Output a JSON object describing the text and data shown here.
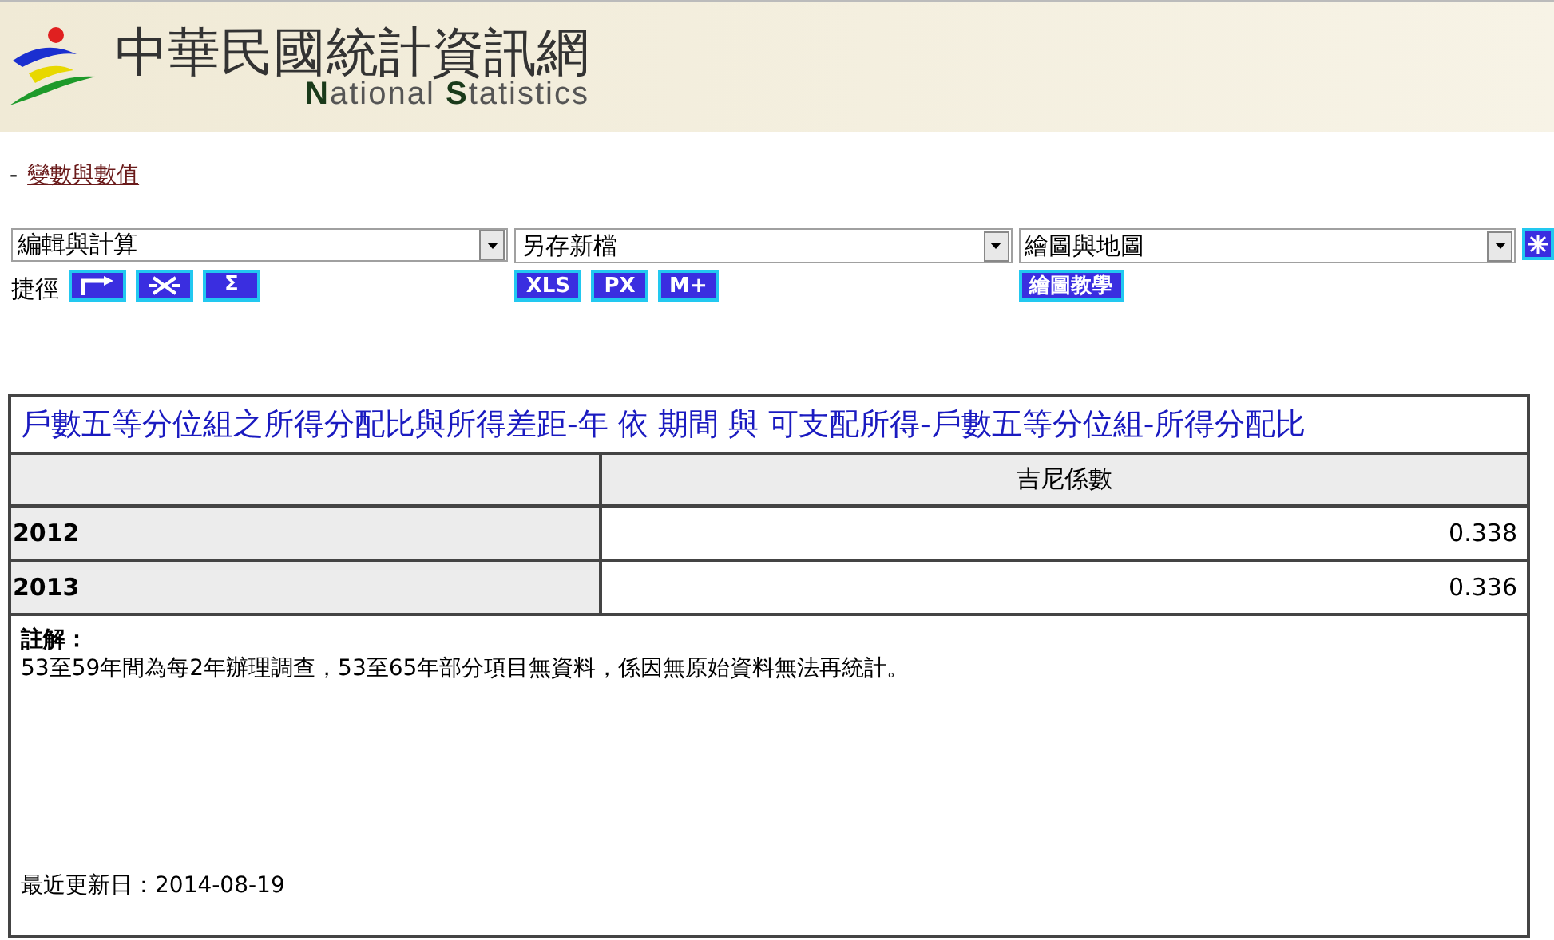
{
  "header": {
    "title": "中華民國統計資訊網",
    "subtitle_initial_1": "N",
    "subtitle_rest_1": "ational",
    "subtitle_initial_2": "S",
    "subtitle_rest_2": "tatistics"
  },
  "breadcrumb": {
    "dash": "-",
    "link": "變數與數值"
  },
  "toolbar": {
    "selects": [
      {
        "value": "編輯與計算"
      },
      {
        "value": "另存新檔"
      },
      {
        "value": "繪圖與地圖"
      }
    ],
    "shortcut_label": "捷徑",
    "groups": [
      [
        {
          "kind": "turn"
        },
        {
          "kind": "cross"
        },
        {
          "kind": "text",
          "label": "Σ"
        }
      ],
      [
        {
          "kind": "text",
          "label": "XLS"
        },
        {
          "kind": "text",
          "label": "PX"
        },
        {
          "kind": "text",
          "label": "M+"
        }
      ],
      [
        {
          "kind": "text",
          "label": "繪圖教學"
        }
      ]
    ]
  },
  "table": {
    "title": "戶數五等分位組之所得分配比與所得差距-年 依 期間 與 可支配所得-戶數五等分位組-所得分配比",
    "columns": [
      "吉尼係數"
    ],
    "rows": [
      {
        "label": "2012",
        "value": "0.338"
      },
      {
        "label": "2013",
        "value": "0.336"
      }
    ],
    "note_title": "註解：",
    "note": "53至59年間為每2年辦理調查，53至65年部分項目無資料，係因無原始資料無法再統計。",
    "updated": "最近更新日：2014-08-19"
  }
}
